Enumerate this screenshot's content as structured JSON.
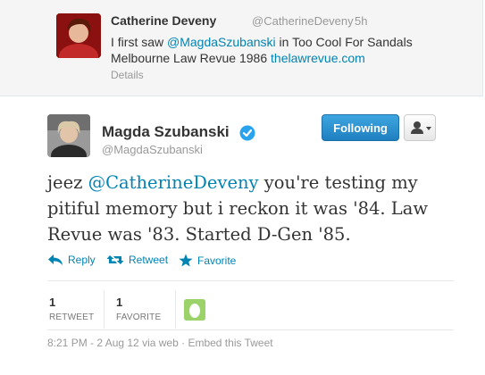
{
  "parent_tweet": {
    "name": "Catherine Deveny",
    "handle": "@CatherineDeveny",
    "time": "5h",
    "text_before": "I first saw ",
    "mention": "@MagdaSzubanski",
    "text_after": " in Too Cool For Sandals Melbourne Law Revue 1986 ",
    "link": "thelawrevue.com",
    "details_label": "Details"
  },
  "tweet": {
    "name": "Magda Szubanski",
    "handle": "@MagdaSzubanski",
    "follow_label": "Following",
    "text_before": "jeez ",
    "mention": "@CatherineDeveny",
    "text_after": " you're testing my pitiful memory but i reckon it was '84. Law Revue was '83. Started D-Gen '85.",
    "actions": {
      "reply": "Reply",
      "retweet": "Retweet",
      "favorite": "Favorite"
    },
    "stats": {
      "retweets_count": "1",
      "retweets_label": "RETWEET",
      "favorites_count": "1",
      "favorites_label": "FAVORITE"
    },
    "timestamp": "8:21 PM - 2 Aug 12 via web",
    "separator": "·",
    "embed_label": "Embed this Tweet"
  },
  "colors": {
    "link": "#0084b4",
    "follow_button": "#2a8fd0",
    "verified": "#2aa3ef"
  },
  "icons": {
    "verified": "verified-badge-icon",
    "reply": "reply-arrow-icon",
    "retweet": "retweet-icon",
    "favorite": "star-icon",
    "user_menu": "user-icon",
    "dropdown": "caret-down-icon",
    "egg_avatar": "egg-avatar-icon"
  }
}
